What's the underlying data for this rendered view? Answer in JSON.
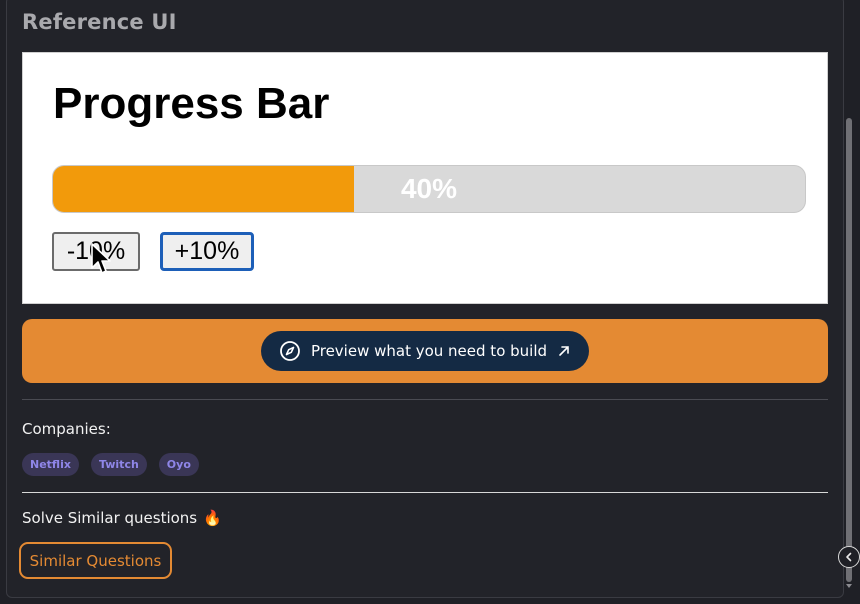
{
  "header": {
    "title": "Reference UI"
  },
  "preview": {
    "heading": "Progress Bar",
    "progress": {
      "value": 40,
      "label": "40%",
      "fill_color": "#f29a0b",
      "track_color": "#d9d9d9"
    },
    "buttons": {
      "decrement": "-10%",
      "increment": "+10%"
    }
  },
  "cta": {
    "label": "Preview what you need to build",
    "icon": "compass-icon",
    "trailing_icon": "arrow-up-right-icon",
    "color": "#e48a33"
  },
  "companies": {
    "label": "Companies:",
    "tags": [
      "Netflix",
      "Twitch",
      "Oyo"
    ]
  },
  "similar": {
    "label": "Solve Similar questions",
    "emoji": "🔥",
    "button": "Similar Questions"
  }
}
